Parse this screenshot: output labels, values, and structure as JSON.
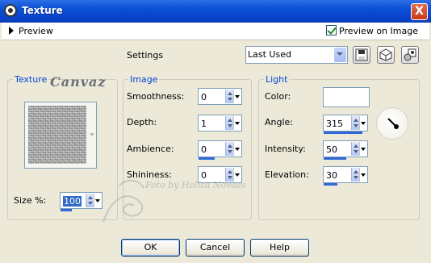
{
  "window": {
    "title": "Texture",
    "close_glyph": "X"
  },
  "preview_bar": {
    "label": "Preview",
    "preview_on_image_label": "Preview on Image",
    "preview_on_image_checked": true
  },
  "settings": {
    "label": "Settings",
    "preset_value": "Last Used"
  },
  "texture_group": {
    "title": "Texture",
    "logo_text": "Canvaz",
    "size_label": "Size %:",
    "size_value": "100"
  },
  "image_group": {
    "title": "Image",
    "smoothness_label": "Smoothness:",
    "smoothness_value": "0",
    "depth_label": "Depth:",
    "depth_value": "1",
    "ambience_label": "Ambience:",
    "ambience_value": "0",
    "shininess_label": "Shininess:",
    "shininess_value": "0"
  },
  "light_group": {
    "title": "Light",
    "color_label": "Color:",
    "color_value": "#ffffff",
    "angle_label": "Angle:",
    "angle_value": "315",
    "intensity_label": "Intensity:",
    "intensity_value": "50",
    "elevation_label": "Elevation:",
    "elevation_value": "30"
  },
  "watermark": "Foto by Helisa Novaes",
  "buttons": {
    "ok": "OK",
    "cancel": "Cancel",
    "help": "Help"
  },
  "icons": {
    "save": "save-preset-icon",
    "reset": "reset-icon",
    "manage": "manage-presets-icon"
  }
}
